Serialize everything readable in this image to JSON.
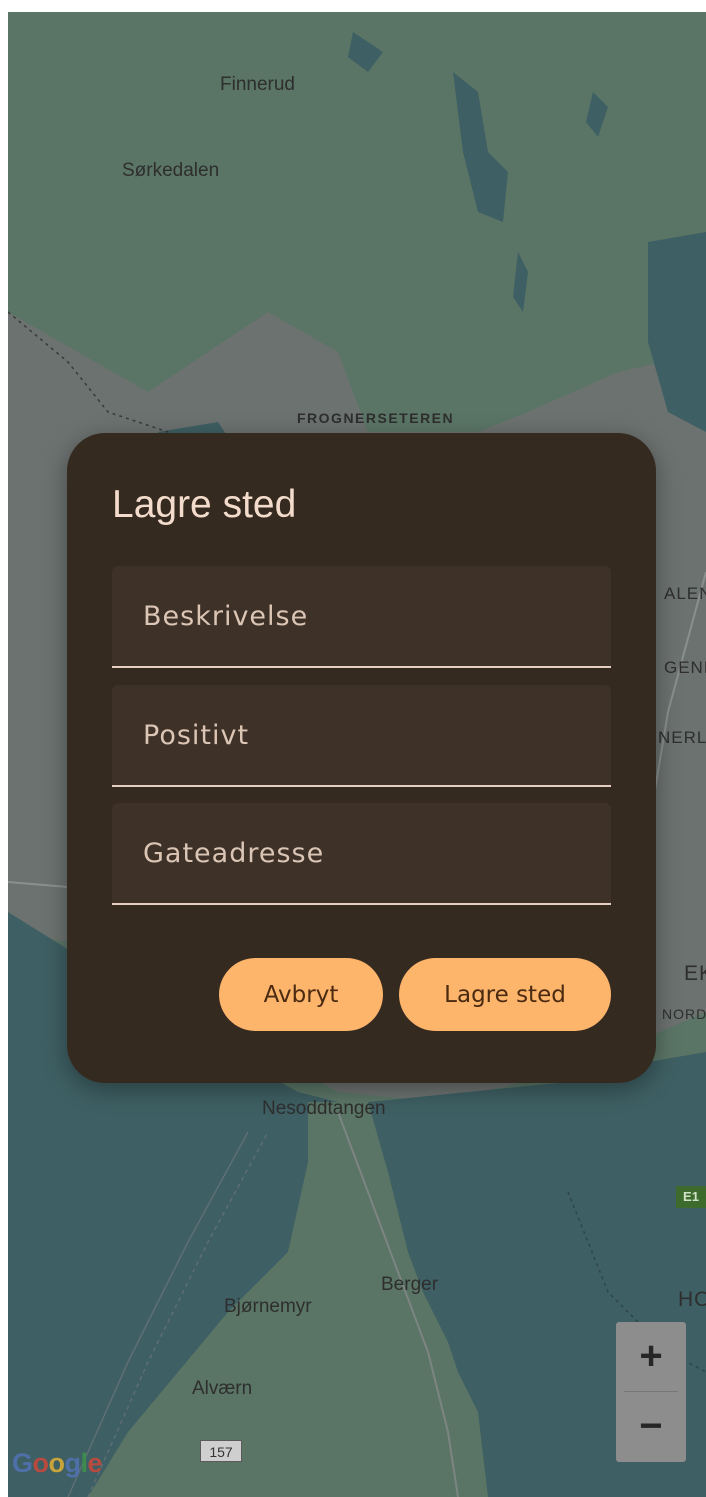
{
  "map": {
    "labels": {
      "finnerud": "Finnerud",
      "sorkedalen": "Sørkedalen",
      "frognerseteren": "FROGNERSETEREN",
      "nesoddtangen": "Nesoddtangen",
      "berger": "Berger",
      "bjornemyr": "Bjørnemyr",
      "alvaern": "Alværn",
      "edge_alen": "ALEN",
      "edge_gene": "GENE",
      "edge_nerl": "NERL",
      "edge_ek": "EK",
      "edge_nord": "NORD",
      "edge_ho": "HO"
    },
    "road_badge": "157",
    "edge_badge": "E1",
    "attribution": "Google",
    "zoom_in": "+",
    "zoom_out": "−",
    "colors": {
      "land": "#5a7566",
      "water": "#3e5f63",
      "urban": "#6c7270",
      "road": "#8b8f8d"
    }
  },
  "dialog": {
    "title": "Lagre sted",
    "fields": {
      "description": {
        "placeholder": "Beskrivelse",
        "value": ""
      },
      "positive": {
        "placeholder": "Positivt",
        "value": ""
      },
      "address": {
        "placeholder": "Gateadresse",
        "value": ""
      }
    },
    "buttons": {
      "cancel": "Avbryt",
      "save": "Lagre sted"
    },
    "colors": {
      "surface": "#352a20",
      "field": "#3e3128",
      "accent": "#fdb46b"
    }
  }
}
